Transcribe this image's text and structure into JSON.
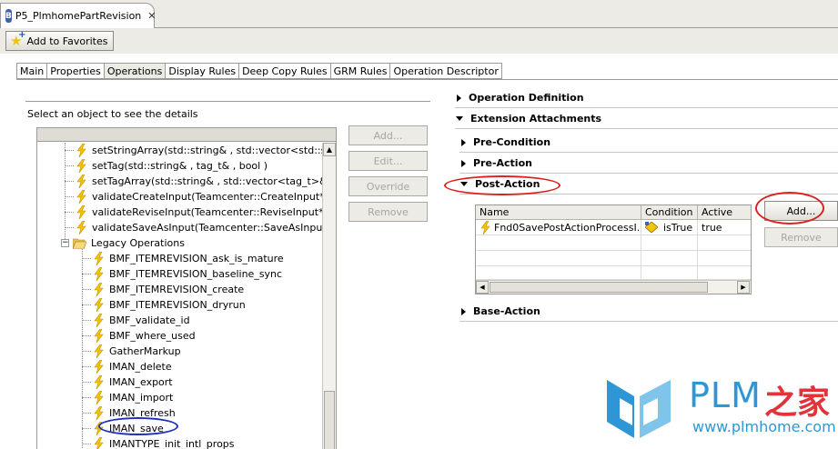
{
  "editor_tab": {
    "title": "P5_PlmhomePartRevision",
    "icon_letter": "B",
    "close_symbol": "✕"
  },
  "toolbar": {
    "add_favorites": "Add to Favorites"
  },
  "main_tabs": [
    "Main",
    "Properties",
    "Operations",
    "Display Rules",
    "Deep Copy Rules",
    "GRM Rules",
    "Operation Descriptor"
  ],
  "active_tab": "Operations",
  "left": {
    "hint": "Select an object to see the details",
    "tree_items": [
      "setStringArray(std::string& , std::vector<std::string",
      "setTag(std::string& , tag_t& , bool )",
      "setTagArray(std::string& , std::vector<tag_t>& , st",
      "validateCreateInput(Teamcenter::CreateInput* )",
      "validateReviseInput(Teamcenter::ReviseInput* , stc",
      "validateSaveAsInput(Teamcenter::SaveAsInput* , s"
    ],
    "folder": {
      "label": "Legacy Operations",
      "expander": "−"
    },
    "legacy_items": [
      "BMF_ITEMREVISION_ask_is_mature",
      "BMF_ITEMREVISION_baseline_sync",
      "BMF_ITEMREVISION_create",
      "BMF_ITEMREVISION_dryrun",
      "BMF_validate_id",
      "BMF_where_used",
      "GatherMarkup",
      "IMAN_delete",
      "IMAN_export",
      "IMAN_import",
      "IMAN_refresh",
      "IMAN_save",
      "IMANTYPE_init_intl_props"
    ],
    "buttons": [
      "Add...",
      "Edit...",
      "Override",
      "Remove"
    ]
  },
  "right": {
    "operation_definition": "Operation Definition",
    "extension_attachments": "Extension Attachments",
    "pre_condition": "Pre-Condition",
    "pre_action": "Pre-Action",
    "post_action": "Post-Action",
    "base_action": "Base-Action",
    "grid": {
      "headers": [
        "Name",
        "Condition",
        "Active"
      ],
      "rows": [
        [
          "Fnd0SavePostActionProcessI...",
          "isTrue",
          "true"
        ]
      ]
    },
    "add_button": "Add...",
    "remove_button": "Remove"
  },
  "watermark": {
    "plm": "PLM",
    "home": "之家",
    "url": "www.plmhome.com"
  },
  "colors": {
    "annotation_red": "#e02020",
    "bolt_yellow": "#f5c400",
    "watermark_blue": "#2f96d6",
    "watermark_red": "#e2323a"
  }
}
